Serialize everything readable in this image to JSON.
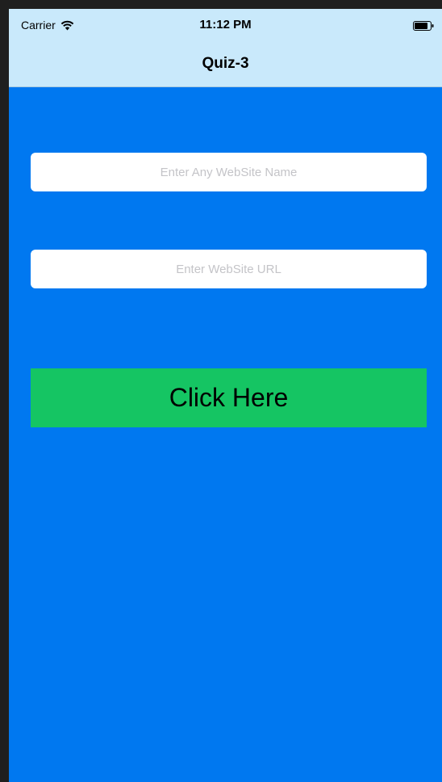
{
  "status_bar": {
    "carrier": "Carrier",
    "time": "11:12 PM",
    "wifi_icon": "wifi-icon",
    "battery_icon": "battery-icon"
  },
  "nav_bar": {
    "title": "Quiz-3",
    "background_color": "#c9e9fb"
  },
  "form": {
    "website_name": {
      "value": "",
      "placeholder": "Enter Any WebSite Name"
    },
    "website_url": {
      "value": "",
      "placeholder": "Enter WebSite URL"
    },
    "button_label": "Click Here",
    "button_color": "#15c563"
  },
  "colors": {
    "background": "#0078f0",
    "field_background": "#ffffff"
  }
}
